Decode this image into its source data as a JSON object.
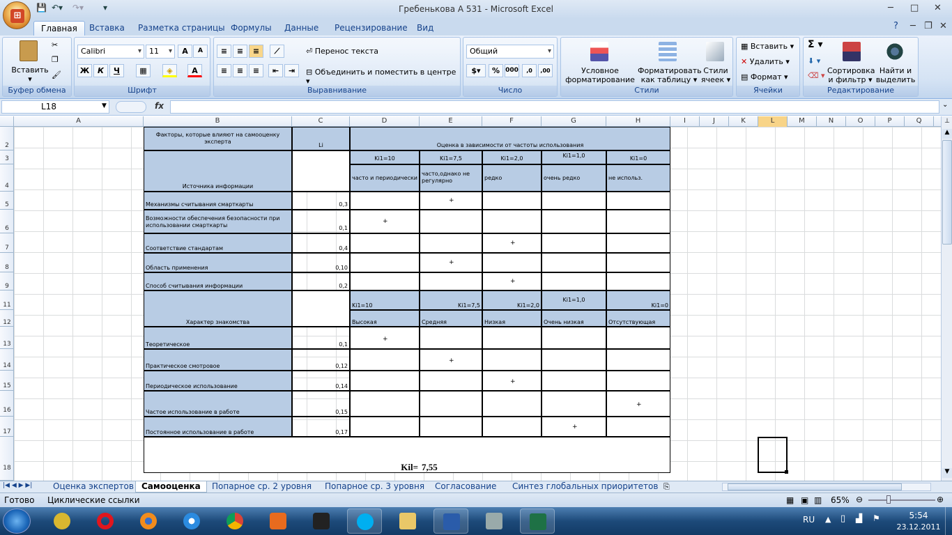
{
  "window": {
    "title": "Гребенькова А 531 - Microsoft Excel"
  },
  "ribbon_tabs": [
    "Главная",
    "Вставка",
    "Разметка страницы",
    "Формулы",
    "Данные",
    "Рецензирование",
    "Вид"
  ],
  "ribbon": {
    "clipboard": {
      "label": "Буфер обмена",
      "paste": "Вставить"
    },
    "font": {
      "label": "Шрифт",
      "name": "Calibri",
      "size": "11",
      "bold": "Ж",
      "italic": "К",
      "underline": "Ч"
    },
    "alignment": {
      "label": "Выравнивание",
      "wrap": "Перенос текста",
      "merge": "Объединить и поместить в центре"
    },
    "number": {
      "label": "Число",
      "format": "Общий"
    },
    "styles": {
      "label": "Стили",
      "cond1": "Условное",
      "cond2": "форматирование",
      "table1": "Форматировать",
      "table2": "как таблицу",
      "cell1": "Стили",
      "cell2": "ячеек"
    },
    "cells": {
      "label": "Ячейки",
      "insert": "Вставить",
      "delete": "Удалить",
      "format": "Формат"
    },
    "editing": {
      "label": "Редактирование",
      "sort1": "Сортировка",
      "sort2": "и фильтр",
      "find1": "Найти и",
      "find2": "выделить"
    }
  },
  "formula_bar": {
    "name_box": "L18",
    "fx": "fx",
    "value": ""
  },
  "columns": [
    "A",
    "B",
    "C",
    "D",
    "E",
    "F",
    "G",
    "H",
    "I",
    "J",
    "K",
    "L",
    "M",
    "N",
    "O",
    "P",
    "Q"
  ],
  "rows": [
    "2",
    "3",
    "4",
    "5",
    "6",
    "7",
    "8",
    "9",
    "11",
    "12",
    "13",
    "14",
    "15",
    "16",
    "17",
    "18"
  ],
  "table": {
    "h_factors": "Факторы, которые влияют на самооценку эксперта",
    "h_li": "Li",
    "h_eval": "Оценка в зависимости от частоты  использования",
    "k10": "Ki1=10",
    "k75": "Ki1=7,5",
    "k20": "Ki1=2,0",
    "k1": "Ki1=1,0",
    "k0": "Ki1=0",
    "h_source": "Источника информации",
    "f1": "часто и периодически",
    "f2": "часто,однако не регулярно",
    "f3": "редко",
    "f4": "очень редко",
    "f5": "не использ.",
    "r5": "Механизмы считывания смарткарты",
    "v5": "0,3",
    "r6": "Возможности обеспечения безопасности при использовании смарткарты",
    "v6": "0,1",
    "r7": "Соответствие стандартам",
    "v7": "0,4",
    "r8": "Область применения",
    "v8": "0,10",
    "r9": "Способ считывания информации",
    "v9": "0,2",
    "h_char": "Характер знакомства",
    "l1": "Высокая",
    "l2": "Средняя",
    "l3": "Низкая",
    "l4": "Очень низкая",
    "l5": "Отсутствующая",
    "r13": "Теоретическое",
    "v13": "0,1",
    "r14": "Практическое смотровое",
    "v14": "0,12",
    "r15": "Периодическое использование",
    "v15": "0,14",
    "r16": "Частое  использование в работе",
    "v16": "0,15",
    "r17": "Постоянное использование в работе",
    "v17": "0,17",
    "plus": "+",
    "kil_label": "Kil=",
    "kil_value": "7,55"
  },
  "sheet_tabs": [
    "Оценка экспертов",
    "Самооценка",
    "Попарное ср. 2 уровня",
    "Попарное ср. 3 уровня",
    "Согласование",
    "Синтез глобальных приоритетов"
  ],
  "status": {
    "ready": "Готово",
    "circular": "Циклические ссылки",
    "zoom": "65%"
  },
  "tray": {
    "lang": "RU",
    "time": "5:54",
    "date": "23.12.2011"
  }
}
